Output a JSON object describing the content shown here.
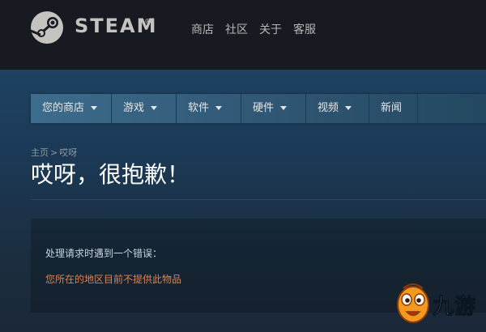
{
  "header": {
    "brand": "STEAM",
    "brand_mark": "®",
    "nav": [
      "商店",
      "社区",
      "关于",
      "客服"
    ]
  },
  "store_nav": {
    "tabs": [
      {
        "label": "您的商店",
        "dropdown": true
      },
      {
        "label": "游戏",
        "dropdown": true
      },
      {
        "label": "软件",
        "dropdown": true
      },
      {
        "label": "硬件",
        "dropdown": true
      },
      {
        "label": "视频",
        "dropdown": true
      },
      {
        "label": "新闻",
        "dropdown": false
      }
    ]
  },
  "breadcrumb": {
    "home": "主页",
    "separator": ">",
    "current": "哎呀"
  },
  "page": {
    "title": "哎呀，很抱歉！"
  },
  "error": {
    "heading": "处理请求时遇到一个错误：",
    "message": "您所在的地区目前不提供此物品"
  },
  "watermark": {
    "text": "九游"
  },
  "colors": {
    "header_bg": "#171a21",
    "accent_error": "#e1814b",
    "nav_bg": "#3d6c8d"
  }
}
